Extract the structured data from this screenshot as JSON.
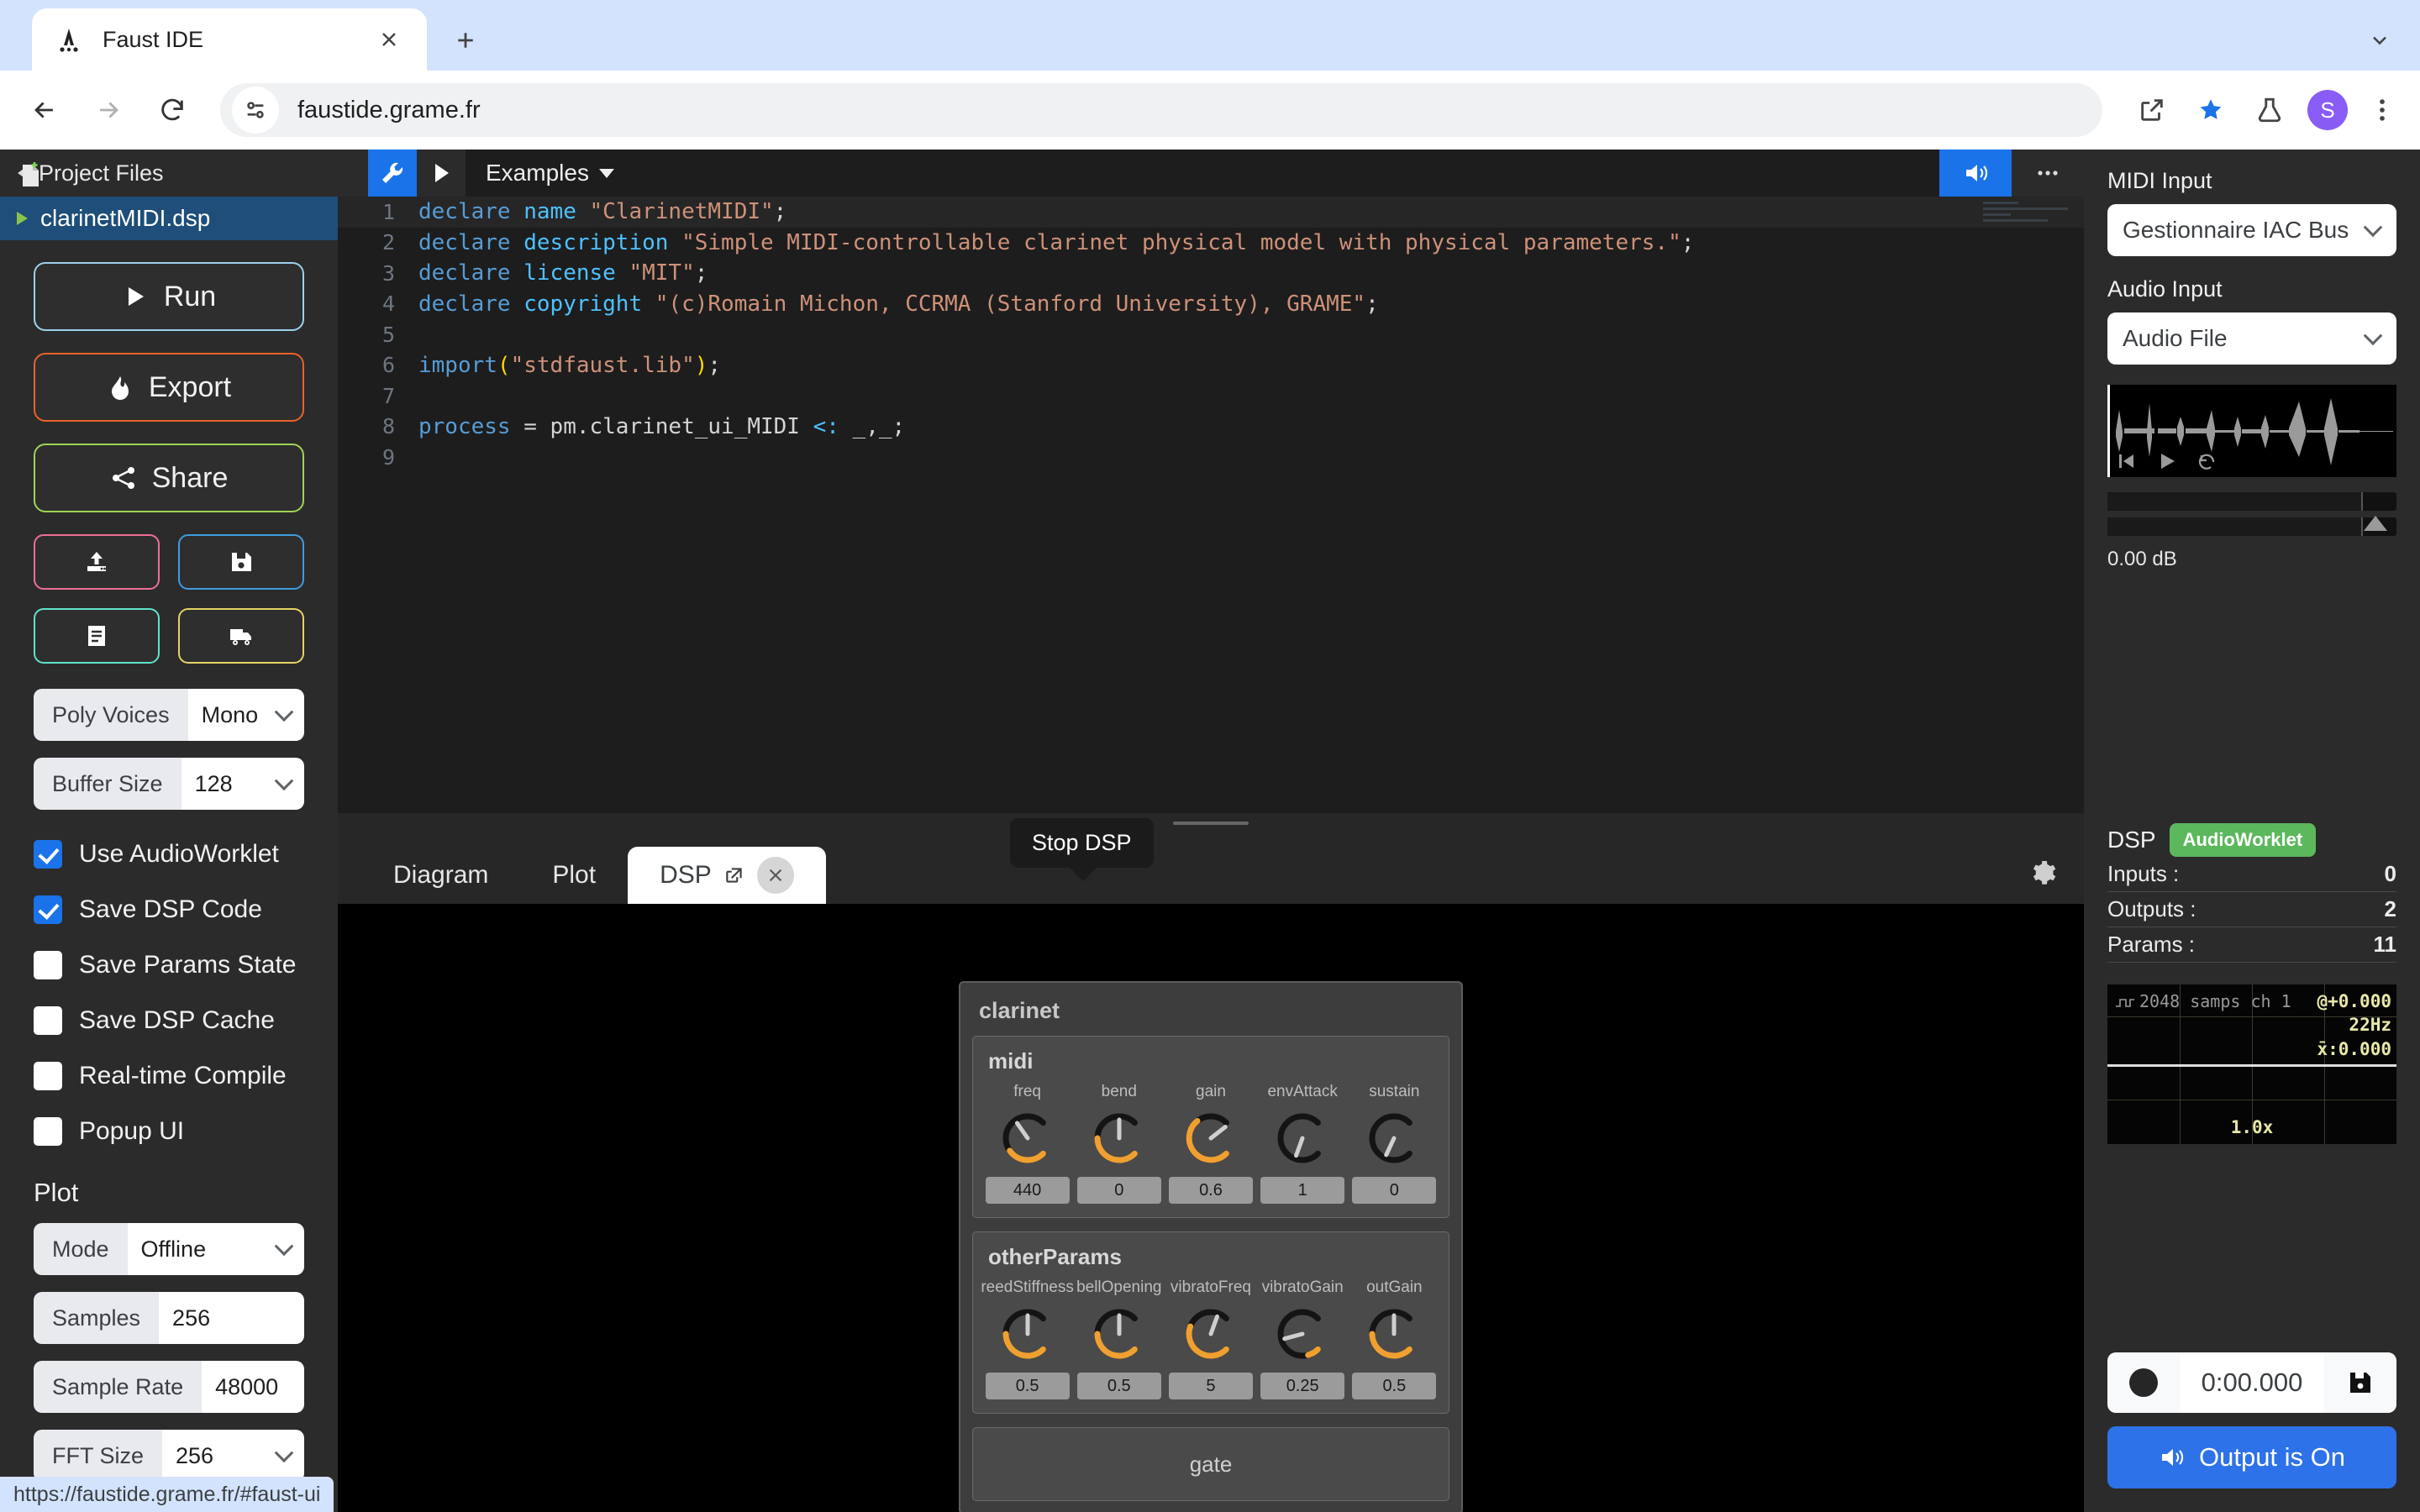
{
  "browser": {
    "tab_title": "Faust IDE",
    "url": "faustide.grame.fr",
    "avatar_initial": "S",
    "status_url": "https://faustide.grame.fr/#faust-ui"
  },
  "sidebar": {
    "header_title": "Project Files",
    "file_name": "clarinetMIDI.dsp",
    "buttons": {
      "run": "Run",
      "export": "Export",
      "share": "Share"
    },
    "mini_buttons": [
      {
        "name": "upload-button",
        "icon": "upload-icon"
      },
      {
        "name": "save-button",
        "icon": "floppy-disk-icon"
      },
      {
        "name": "docs-button",
        "icon": "document-icon"
      },
      {
        "name": "deploy-button",
        "icon": "truck-icon"
      }
    ],
    "fields": [
      {
        "label": "Poly Voices",
        "value": "Mono",
        "type": "select"
      },
      {
        "label": "Buffer Size",
        "value": "128",
        "type": "select"
      }
    ],
    "checkboxes": [
      {
        "label": "Use AudioWorklet",
        "checked": true
      },
      {
        "label": "Save DSP Code",
        "checked": true
      },
      {
        "label": "Save Params State",
        "checked": false
      },
      {
        "label": "Save DSP Cache",
        "checked": false
      },
      {
        "label": "Real-time Compile",
        "checked": false
      },
      {
        "label": "Popup UI",
        "checked": false
      }
    ],
    "plot_section_title": "Plot",
    "plot_fields": [
      {
        "label": "Mode",
        "value": "Offline",
        "type": "select"
      },
      {
        "label": "Samples",
        "value": "256",
        "type": "input"
      },
      {
        "label": "Sample Rate",
        "value": "48000",
        "type": "input"
      },
      {
        "label": "FFT Size",
        "value": "256",
        "type": "select"
      }
    ]
  },
  "editor": {
    "toolbar": {
      "wrench_label": "wrench-icon",
      "run_label": "play-icon",
      "examples": "Examples"
    },
    "lines": [
      {
        "n": "1",
        "tokens": [
          {
            "t": "declare ",
            "c": "k-blue"
          },
          {
            "t": "name ",
            "c": "k-cyan"
          },
          {
            "t": "\"ClarinetMIDI\"",
            "c": "k-str"
          },
          {
            "t": ";",
            "c": "k-white"
          }
        ]
      },
      {
        "n": "2",
        "tokens": [
          {
            "t": "declare ",
            "c": "k-blue"
          },
          {
            "t": "description ",
            "c": "k-cyan"
          },
          {
            "t": "\"Simple MIDI-controllable clarinet physical model with physical parameters.\"",
            "c": "k-str"
          },
          {
            "t": ";",
            "c": "k-white"
          }
        ]
      },
      {
        "n": "3",
        "tokens": [
          {
            "t": "declare ",
            "c": "k-blue"
          },
          {
            "t": "license ",
            "c": "k-cyan"
          },
          {
            "t": "\"MIT\"",
            "c": "k-str"
          },
          {
            "t": ";",
            "c": "k-white"
          }
        ]
      },
      {
        "n": "4",
        "tokens": [
          {
            "t": "declare ",
            "c": "k-blue"
          },
          {
            "t": "copyright ",
            "c": "k-cyan"
          },
          {
            "t": "\"(c)Romain Michon, CCRMA (Stanford University), GRAME\"",
            "c": "k-str"
          },
          {
            "t": ";",
            "c": "k-white"
          }
        ]
      },
      {
        "n": "5",
        "tokens": []
      },
      {
        "n": "6",
        "tokens": [
          {
            "t": "import",
            "c": "k-blue"
          },
          {
            "t": "(",
            "c": "k-yellow"
          },
          {
            "t": "\"stdfaust.lib\"",
            "c": "k-str"
          },
          {
            "t": ")",
            "c": "k-yellow"
          },
          {
            "t": ";",
            "c": "k-white"
          }
        ]
      },
      {
        "n": "7",
        "tokens": []
      },
      {
        "n": "8",
        "tokens": [
          {
            "t": "process ",
            "c": "k-blue"
          },
          {
            "t": "= pm.clarinet_ui_MIDI ",
            "c": "k-white"
          },
          {
            "t": "<: ",
            "c": "k-cyan"
          },
          {
            "t": "_,_;",
            "c": "k-white"
          }
        ]
      },
      {
        "n": "9",
        "tokens": []
      }
    ]
  },
  "bottom_panel": {
    "tabs": [
      {
        "label": "Diagram",
        "active": false
      },
      {
        "label": "Plot",
        "active": false
      },
      {
        "label": "DSP",
        "active": true
      }
    ],
    "tooltip": "Stop DSP"
  },
  "faust_ui": {
    "panel_title": "clarinet",
    "groups": [
      {
        "title": "midi",
        "knobs": [
          {
            "label": "freq",
            "value": "440",
            "angle": -35,
            "arc": true
          },
          {
            "label": "bend",
            "value": "0",
            "angle": 0,
            "arc": true
          },
          {
            "label": "gain",
            "value": "0.6",
            "angle": 52,
            "arc": true
          },
          {
            "label": "envAttack",
            "value": "1",
            "angle": 200,
            "arc": false
          },
          {
            "label": "sustain",
            "value": "0",
            "angle": 205,
            "arc": false
          }
        ]
      },
      {
        "title": "otherParams",
        "knobs": [
          {
            "label": "reedStiffness",
            "value": "0.5",
            "angle": 0,
            "arc": true
          },
          {
            "label": "bellOpening",
            "value": "0.5",
            "angle": 0,
            "arc": true
          },
          {
            "label": "vibratoFreq",
            "value": "5",
            "angle": 20,
            "arc": true
          },
          {
            "label": "vibratoGain",
            "value": "0.25",
            "angle": 255,
            "arc": true
          },
          {
            "label": "outGain",
            "value": "0.5",
            "angle": 0,
            "arc": true
          }
        ]
      }
    ],
    "gate_label": "gate"
  },
  "right_panel": {
    "midi_input_label": "MIDI Input",
    "midi_input_value": "Gestionnaire IAC Bus",
    "audio_input_label": "Audio Input",
    "audio_input_value": "Audio File",
    "gain_db": "0.00 dB",
    "dsp_label": "DSP",
    "dsp_badge": "AudioWorklet",
    "stats": [
      {
        "label": "Inputs :",
        "value": "0"
      },
      {
        "label": "Outputs :",
        "value": "2"
      },
      {
        "label": "Params :",
        "value": "11"
      }
    ],
    "scope": {
      "top_left": "2048 samps ch 1",
      "offset": "@+0.000",
      "freq": "22Hz",
      "mean": "x̄:0.000",
      "zoom": "1.0x"
    },
    "record_time": "0:00.000",
    "output_button": "Output is On"
  },
  "colors": {
    "accent_blue": "#1a73e8",
    "run_border": "#9cd2ea",
    "export_border": "#e8622a",
    "share_border": "#9fd356",
    "badge_green": "#5cb85c",
    "knob_arc": "#f0a030"
  }
}
